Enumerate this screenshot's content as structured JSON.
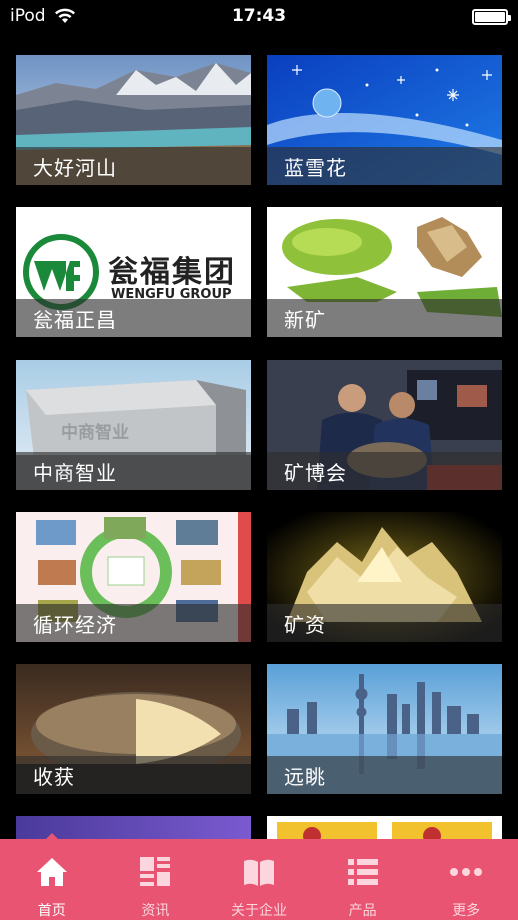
{
  "status": {
    "carrier": "iPod",
    "time": "17:43"
  },
  "tiles": [
    {
      "label": "大好河山"
    },
    {
      "label": "蓝雪花"
    },
    {
      "label": "瓮福正昌",
      "logo_text": "瓮福集团",
      "logo_sub": "WENGFU GROUP"
    },
    {
      "label": "新矿"
    },
    {
      "label": "中商智业",
      "stone_text": "中商智业"
    },
    {
      "label": "矿博会"
    },
    {
      "label": "循环经济"
    },
    {
      "label": "矿资"
    },
    {
      "label": "收获"
    },
    {
      "label": "远眺"
    },
    {
      "label": ""
    },
    {
      "label": ""
    }
  ],
  "tabs": [
    {
      "label": "首页",
      "icon": "home-icon",
      "active": true
    },
    {
      "label": "资讯",
      "icon": "grid-list-icon"
    },
    {
      "label": "关于企业",
      "icon": "book-icon"
    },
    {
      "label": "产品",
      "icon": "list-icon"
    },
    {
      "label": "更多",
      "icon": "more-icon"
    }
  ],
  "colors": {
    "tabbar": "#e85471",
    "background": "#000000"
  }
}
